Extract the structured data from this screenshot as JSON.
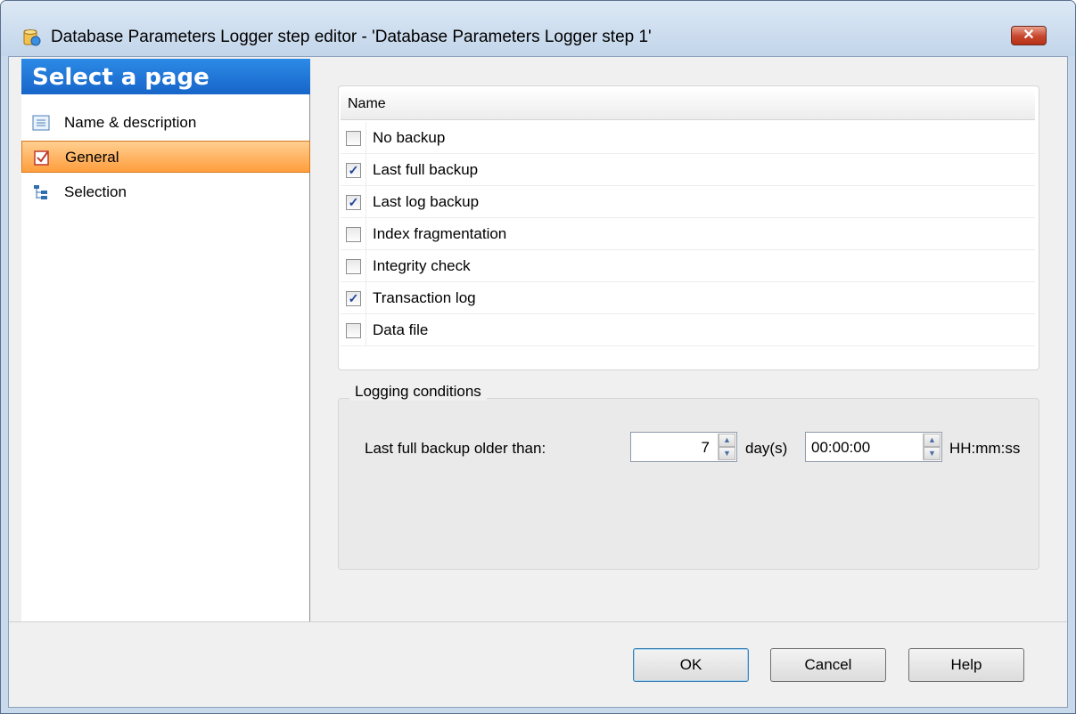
{
  "window": {
    "title": "Database Parameters Logger step editor - 'Database Parameters Logger step 1'",
    "close_glyph": "✕"
  },
  "nav": {
    "header": "Select a page",
    "items": [
      {
        "label": "Name & description",
        "icon": "list-document-icon",
        "active": false
      },
      {
        "label": "General",
        "icon": "checkbox-icon",
        "active": true
      },
      {
        "label": "Selection",
        "icon": "tree-icon",
        "active": false
      }
    ]
  },
  "checklist": {
    "column_header": "Name",
    "items": [
      {
        "label": "No backup",
        "checked": false
      },
      {
        "label": "Last full backup",
        "checked": true
      },
      {
        "label": "Last log backup",
        "checked": true
      },
      {
        "label": "Index fragmentation",
        "checked": false
      },
      {
        "label": "Integrity check",
        "checked": false
      },
      {
        "label": "Transaction log",
        "checked": true
      },
      {
        "label": "Data file",
        "checked": false
      }
    ]
  },
  "logging": {
    "title": "Logging conditions",
    "label": "Last full backup older than:",
    "days_value": "7",
    "days_unit": "day(s)",
    "time_value": "00:00:00",
    "time_unit": "HH:mm:ss"
  },
  "buttons": {
    "ok": "OK",
    "cancel": "Cancel",
    "help": "Help"
  },
  "colors": {
    "nav_header": "#1f74d8",
    "active_item": "#ff9e3d",
    "check_mark": "#21419c"
  }
}
